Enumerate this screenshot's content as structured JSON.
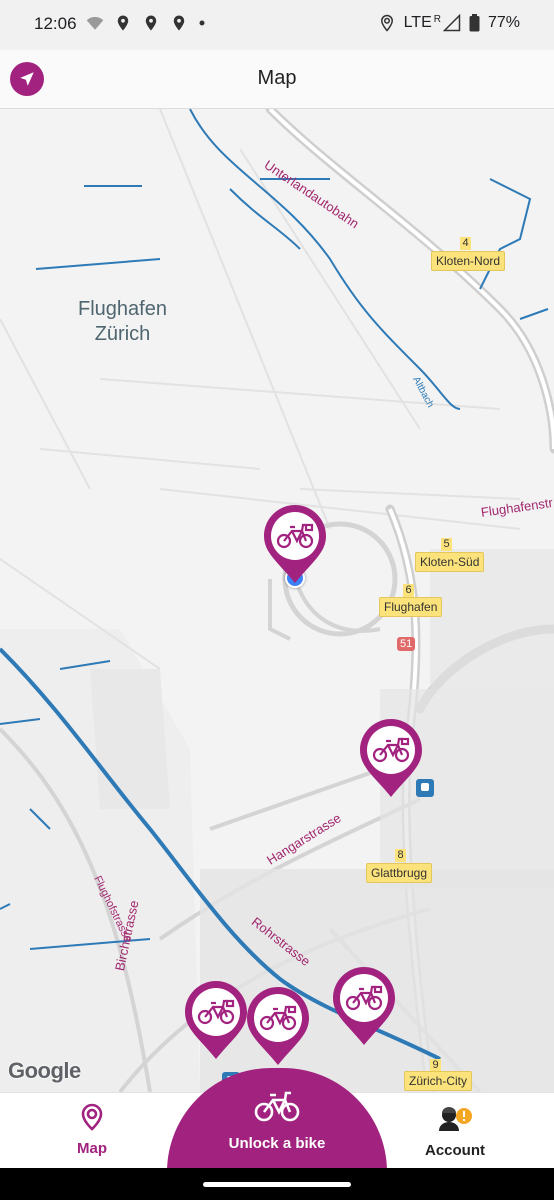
{
  "status_bar": {
    "time": "12:06",
    "network": "LTE",
    "roaming": "R",
    "battery": "77%"
  },
  "app_bar": {
    "title": "Map",
    "locate_icon": "navigation-arrow-icon"
  },
  "map": {
    "area_label": "Flughafen\nZürich",
    "road_labels": [
      "Unterlandautobahn",
      "Altbach",
      "Flughafenstr",
      "Hangarstrasse",
      "Flughofstrasse",
      "Birchstrasse",
      "Rohrstrasse"
    ],
    "stations": [
      {
        "num": "4",
        "name": "Kloten-Nord"
      },
      {
        "num": "5",
        "name": "Kloten-Süd"
      },
      {
        "num": "6",
        "name": "Flughafen"
      },
      {
        "num": "8",
        "name": "Glattbrugg"
      },
      {
        "num": "9",
        "name": "Zürich-City"
      }
    ],
    "route_shield": "51",
    "provider_logo": "Google",
    "bike_pins": 5
  },
  "bottom_nav": {
    "map_label": "Map",
    "unlock_label": "Unlock a bike",
    "account_label": "Account"
  },
  "colors": {
    "brand": "#a2237f",
    "water": "#2e7ab6",
    "exit_badge": "#fbe27a"
  }
}
